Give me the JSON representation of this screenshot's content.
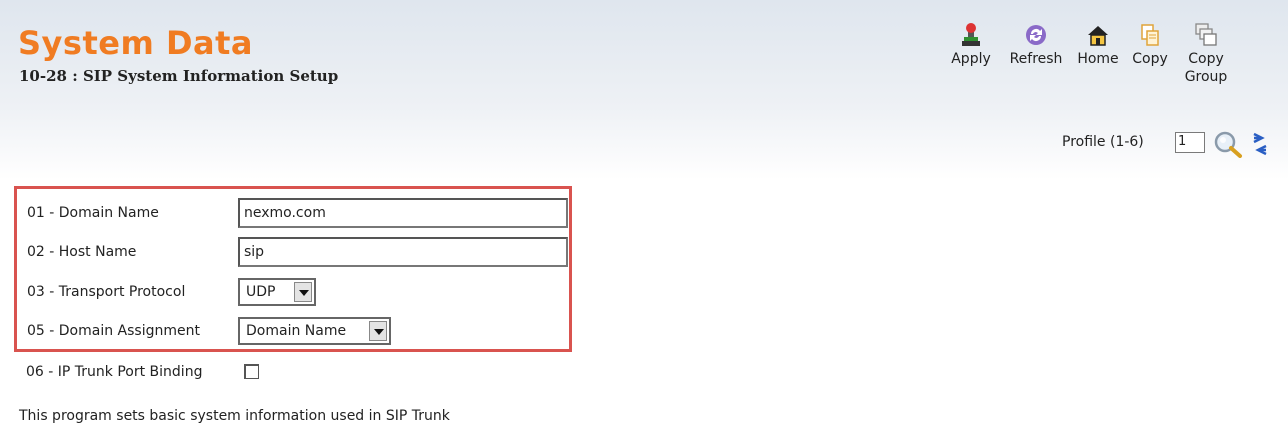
{
  "header": {
    "title": "System Data",
    "subtitle": "10-28 : SIP System Information Setup"
  },
  "toolbar": {
    "apply": {
      "label": "Apply",
      "icon": "apply-icon"
    },
    "refresh": {
      "label": "Refresh",
      "icon": "refresh-icon"
    },
    "home": {
      "label": "Home",
      "icon": "home-icon"
    },
    "copy": {
      "label": "Copy",
      "icon": "copy-icon"
    },
    "copy_group": {
      "label_line1": "Copy",
      "label_line2": "Group",
      "icon": "copy-group-icon"
    }
  },
  "profile": {
    "label": "Profile (1-6)",
    "value": "1"
  },
  "form": {
    "domain_name": {
      "label": "01 - Domain Name",
      "value": "nexmo.com"
    },
    "host_name": {
      "label": "02 - Host Name",
      "value": "sip"
    },
    "transport_protocol": {
      "label": "03 - Transport Protocol",
      "value": "UDP"
    },
    "domain_assignment": {
      "label": "05 - Domain Assignment",
      "value": "Domain Name"
    },
    "ip_trunk_port_binding": {
      "label": "06 - IP Trunk Port Binding",
      "checked": false
    }
  },
  "description": "This program sets basic system information used in SIP Trunk",
  "colors": {
    "title": "#f07c22",
    "highlight_border": "#d9534f"
  }
}
